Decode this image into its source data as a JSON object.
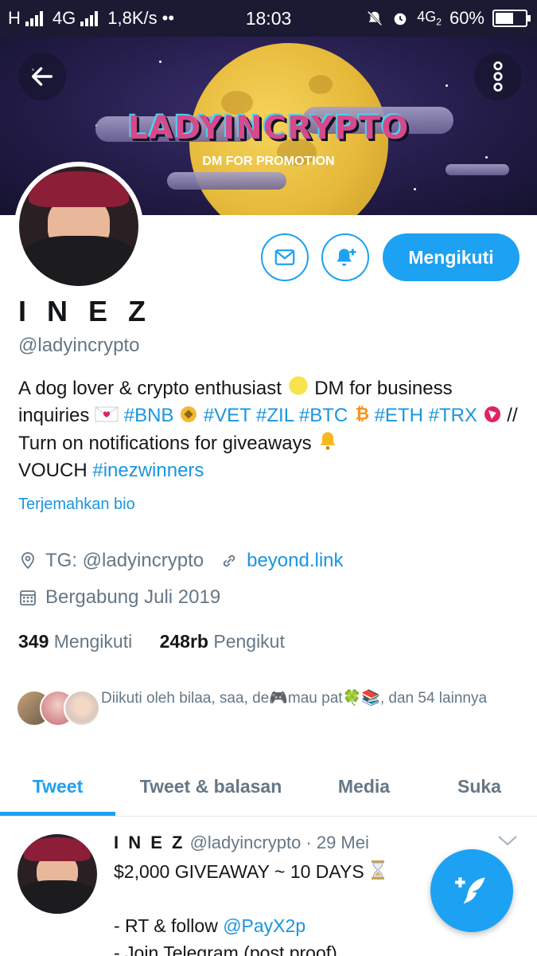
{
  "status_bar": {
    "network_left": "H",
    "network_mid": "4G",
    "speed": "1,8K/s",
    "dots": "••",
    "time": "18:03",
    "network_right": "4G",
    "network_right_sub": "2",
    "battery_percent": "60%",
    "battery_level": 0.6
  },
  "banner": {
    "logo_text": "LADYINCRYPTO",
    "subtitle": "DM FOR PROMOTION"
  },
  "profile": {
    "name": "I N E Z",
    "handle": "@ladyincrypto",
    "follow_button": "Mengikuti",
    "bio": {
      "t1": "A dog lover & crypto enthusiast",
      "t2": "DM for business inquiries",
      "tag_bnb": "#BNB",
      "tag_vet": "#VET",
      "tag_zil": "#ZIL",
      "tag_btc": "#BTC",
      "tag_eth": "#ETH",
      "tag_trx": "#TRX",
      "t3": "// Turn on notifications for giveaways",
      "t4": "VOUCH",
      "tag_inez": "#inezwinners"
    },
    "translate_bio": "Terjemahkan bio",
    "location": "TG: @ladyincrypto",
    "website": "beyond.link",
    "joined": "Bergabung Juli 2019",
    "following_count": "349",
    "following_label": "Mengikuti",
    "followers_count": "248rb",
    "followers_label": "Pengikut",
    "followed_by": "Diikuti oleh bilaa, saa, de🎮mau pat🍀📚, dan 54 lainnya"
  },
  "tabs": [
    {
      "label": "Tweet",
      "active": true
    },
    {
      "label": "Tweet & balasan",
      "active": false
    },
    {
      "label": "Media",
      "active": false
    },
    {
      "label": "Suka",
      "active": false
    }
  ],
  "tweet": {
    "author": "I N E Z",
    "handle_date": "@ladyincrypto · 29 Mei",
    "line1": "$2,000 GIVEAWAY ~ 10 DAYS",
    "line2_prefix": "- RT & follow",
    "line2_mention": "@PayX2p",
    "line3": "- Join Telegram (post proof)"
  },
  "colors": {
    "accent": "#1da1f2",
    "link": "#1b95e0",
    "muted": "#657786",
    "text": "#14171a",
    "status_bar": "#1b1a33"
  }
}
